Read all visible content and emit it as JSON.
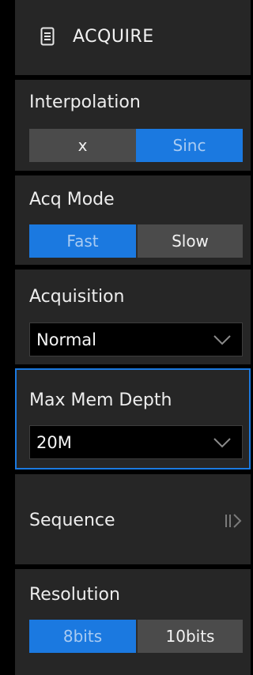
{
  "header": {
    "title": "ACQUIRE",
    "icon": "document-icon"
  },
  "interpolation": {
    "label": "Interpolation",
    "options": [
      "x",
      "Sinc"
    ],
    "selected": "Sinc"
  },
  "acq_mode": {
    "label": "Acq Mode",
    "options": [
      "Fast",
      "Slow"
    ],
    "selected": "Fast"
  },
  "acquisition": {
    "label": "Acquisition",
    "value": "Normal"
  },
  "max_mem_depth": {
    "label": "Max Mem Depth",
    "value": "20M"
  },
  "sequence": {
    "label": "Sequence",
    "icon": "expand-arrow-icon"
  },
  "resolution": {
    "label": "Resolution",
    "options": [
      "8bits",
      "10bits"
    ],
    "selected": "8bits"
  },
  "colors": {
    "accent": "#1b79e0",
    "panel": "#262626",
    "button_off": "#4b4b4b",
    "background": "#000000"
  }
}
